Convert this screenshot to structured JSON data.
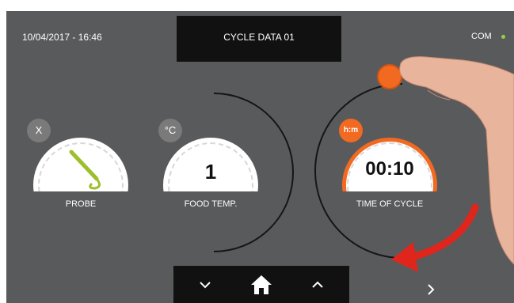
{
  "header": {
    "datetime": "10/04/2017 - 16:46",
    "title": "CYCLE DATA 01",
    "status": "COM"
  },
  "gauges": [
    {
      "badge": "X",
      "label": "PROBE",
      "value": ""
    },
    {
      "badge": "°C",
      "label": "FOOD TEMP.",
      "value": "1"
    },
    {
      "badge": "h:m",
      "label": "TIME OF CYCLE",
      "value": "00:10"
    }
  ],
  "nav": {
    "down": "down-chevron",
    "home": "home",
    "up": "up-chevron",
    "next": "right-chevron"
  },
  "colors": {
    "accent": "#f26a21",
    "background": "#595a5c",
    "bar": "#111111",
    "status": "#8fd14f",
    "arrow": "#e0261c"
  }
}
